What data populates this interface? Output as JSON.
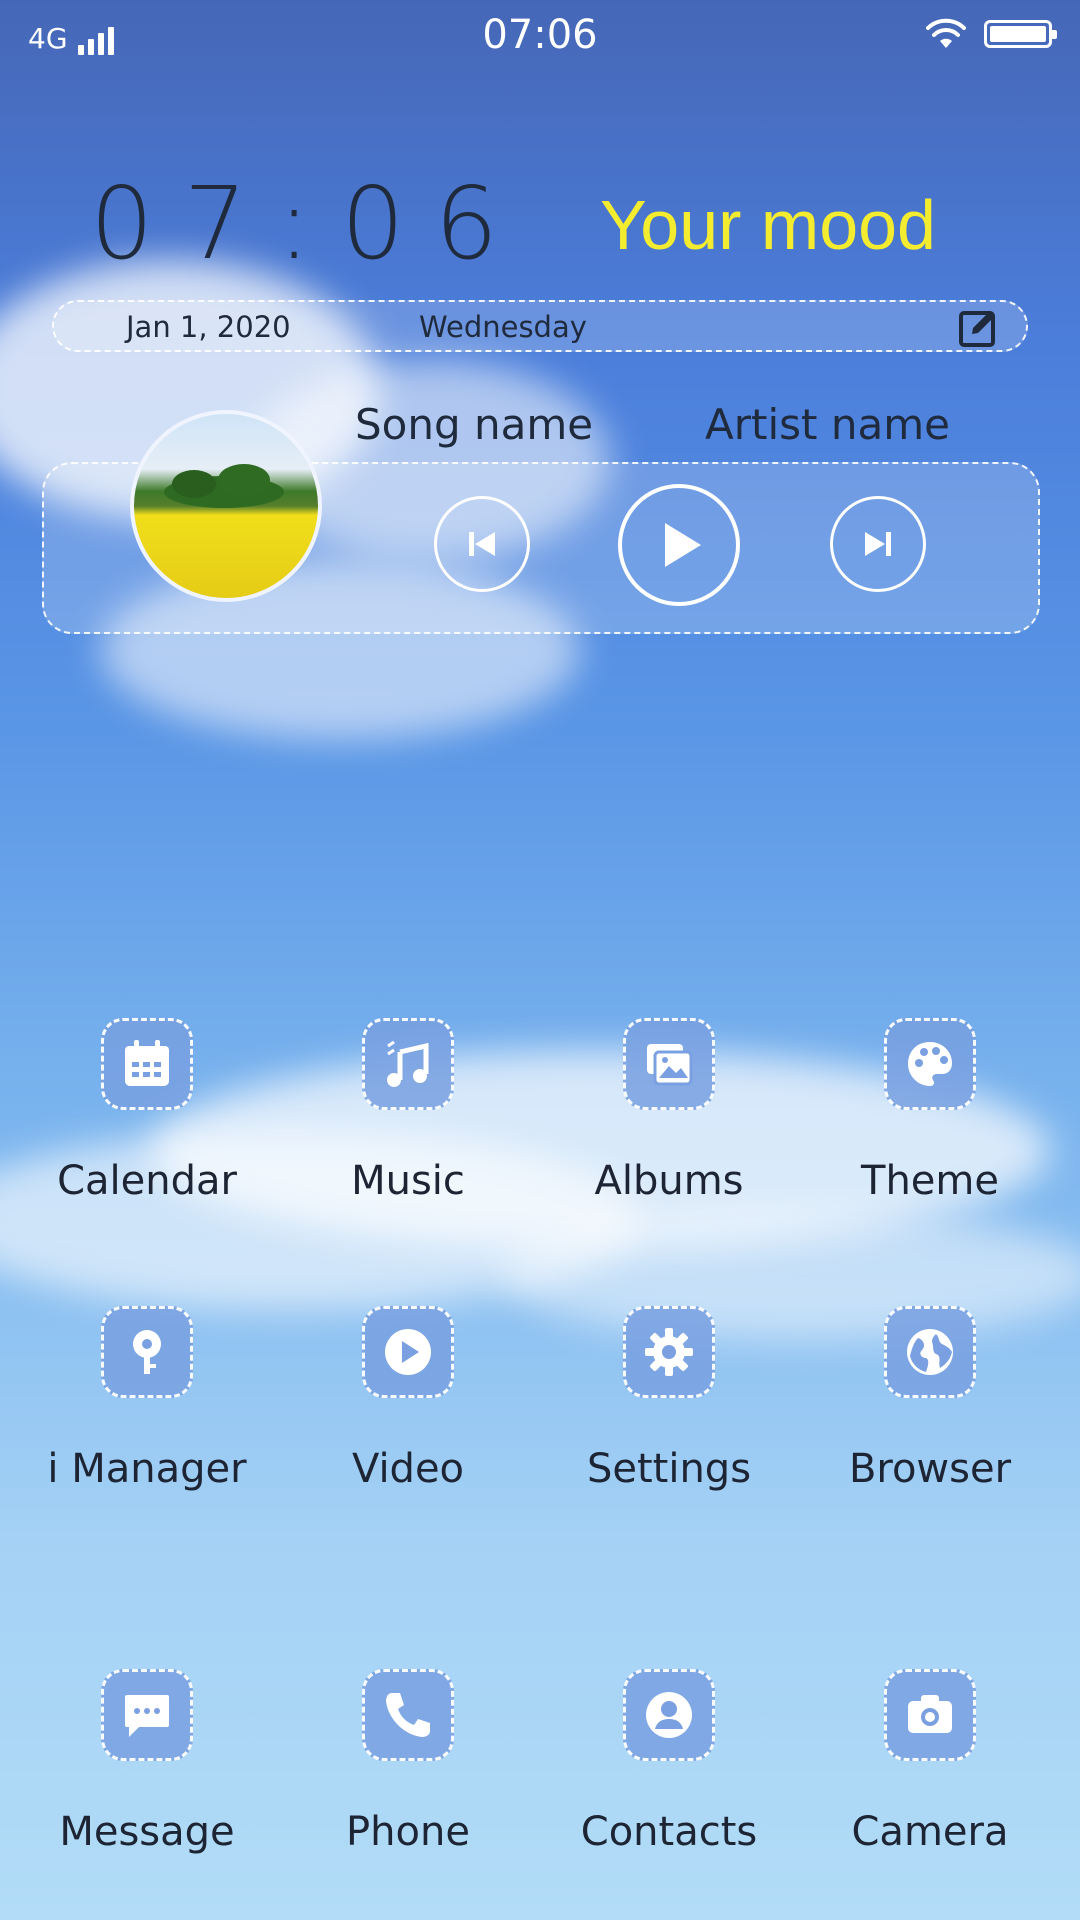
{
  "status_bar": {
    "network": "4G",
    "time": "07:06"
  },
  "widget": {
    "clock": "07:06",
    "mood": "Your mood",
    "date": "Jan 1, 2020",
    "weekday": "Wednesday"
  },
  "music": {
    "song": "Song name",
    "artist": "Artist name"
  },
  "apps": [
    {
      "label": "Calendar",
      "icon": "calendar-icon"
    },
    {
      "label": "Music",
      "icon": "music-note-icon"
    },
    {
      "label": "Albums",
      "icon": "album-icon"
    },
    {
      "label": "Theme",
      "icon": "palette-icon"
    },
    {
      "label": "i Manager",
      "icon": "manager-icon"
    },
    {
      "label": "Video",
      "icon": "play-icon"
    },
    {
      "label": "Settings",
      "icon": "gear-icon"
    },
    {
      "label": "Browser",
      "icon": "globe-icon"
    },
    {
      "label": "Message",
      "icon": "chat-icon"
    },
    {
      "label": "Phone",
      "icon": "phone-icon"
    },
    {
      "label": "Contacts",
      "icon": "contact-icon"
    },
    {
      "label": "Camera",
      "icon": "camera-icon"
    }
  ],
  "colors": {
    "mood_text": "#f3ec2f",
    "icon_bg": "#7aa0e1"
  }
}
